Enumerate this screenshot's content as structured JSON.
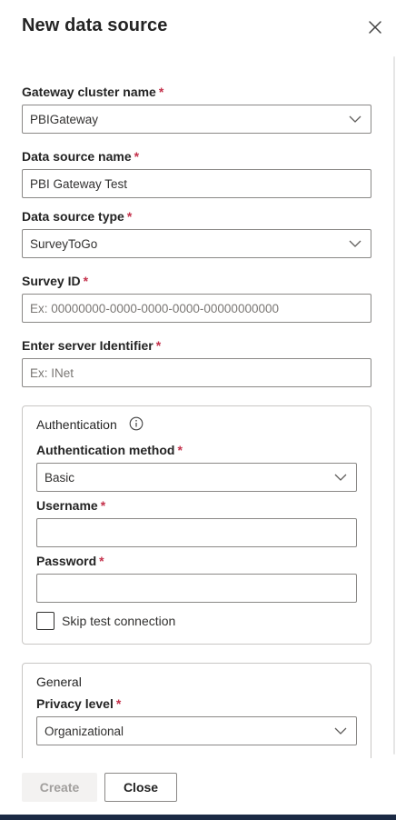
{
  "panel": {
    "title": "New data source",
    "required_marker": "*"
  },
  "gateway_cluster": {
    "label": "Gateway cluster name",
    "value": "PBIGateway"
  },
  "data_source_name": {
    "label": "Data source name",
    "value": "PBI Gateway Test"
  },
  "data_source_type": {
    "label": "Data source type",
    "value": "SurveyToGo"
  },
  "survey_id": {
    "label": "Survey ID",
    "placeholder": "Ex: 00000000-0000-0000-0000-00000000000"
  },
  "server_identifier": {
    "label": "Enter server Identifier",
    "placeholder": "Ex: INet"
  },
  "authentication": {
    "title": "Authentication",
    "method_label": "Authentication method",
    "method_value": "Basic",
    "username_label": "Username",
    "username_value": "",
    "password_label": "Password",
    "password_value": "",
    "skip_test_label": "Skip test connection"
  },
  "general": {
    "title": "General",
    "privacy_label": "Privacy level",
    "privacy_value": "Organizational"
  },
  "footer": {
    "create_label": "Create",
    "close_label": "Close"
  }
}
